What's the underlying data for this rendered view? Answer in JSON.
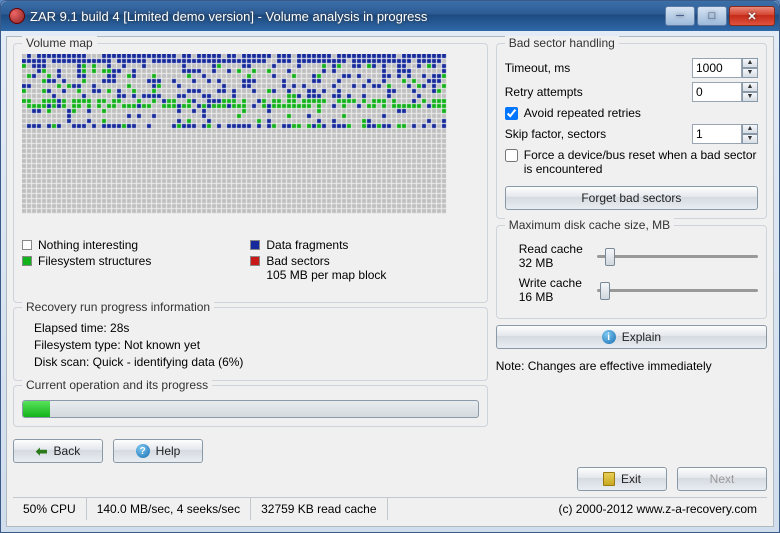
{
  "window": {
    "title": "ZAR 9.1 build 4 [Limited demo version] - Volume analysis in progress"
  },
  "volmap": {
    "legend": "Volume map",
    "legend_nothing": "Nothing interesting",
    "legend_fs": "Filesystem structures",
    "legend_data": "Data fragments",
    "legend_bad": "Bad sectors",
    "block_size": "105 MB per map block"
  },
  "progress": {
    "legend": "Recovery run progress information",
    "elapsed": "Elapsed time: 28s",
    "fstype": "Filesystem type: Not known yet",
    "diskscan": "Disk scan: Quick - identifying data (6%)"
  },
  "curop": {
    "legend": "Current operation and its progress",
    "percent": 6
  },
  "bad": {
    "legend": "Bad sector handling",
    "timeout_label": "Timeout, ms",
    "timeout_value": "1000",
    "retry_label": "Retry attempts",
    "retry_value": "0",
    "avoid_label": "Avoid repeated retries",
    "avoid_checked": true,
    "skip_label": "Skip factor, sectors",
    "skip_value": "1",
    "force_label": "Force a device/bus reset when a bad sector is encountered",
    "force_checked": false,
    "forget_btn": "Forget bad sectors"
  },
  "cache": {
    "legend": "Maximum disk cache size, MB",
    "read_label": "Read cache",
    "read_value": "32 MB",
    "write_label": "Write cache",
    "write_value": "16 MB"
  },
  "explain_btn": "Explain",
  "note": "Note: Changes are effective immediately",
  "buttons": {
    "back": "Back",
    "help": "Help",
    "exit": "Exit",
    "next": "Next"
  },
  "status": {
    "cpu": "50% CPU",
    "io": "140.0 MB/sec, 4 seeks/sec",
    "cache": "32759 KB read cache",
    "copyright": "(c) 2000-2012 www.z-a-recovery.com"
  }
}
